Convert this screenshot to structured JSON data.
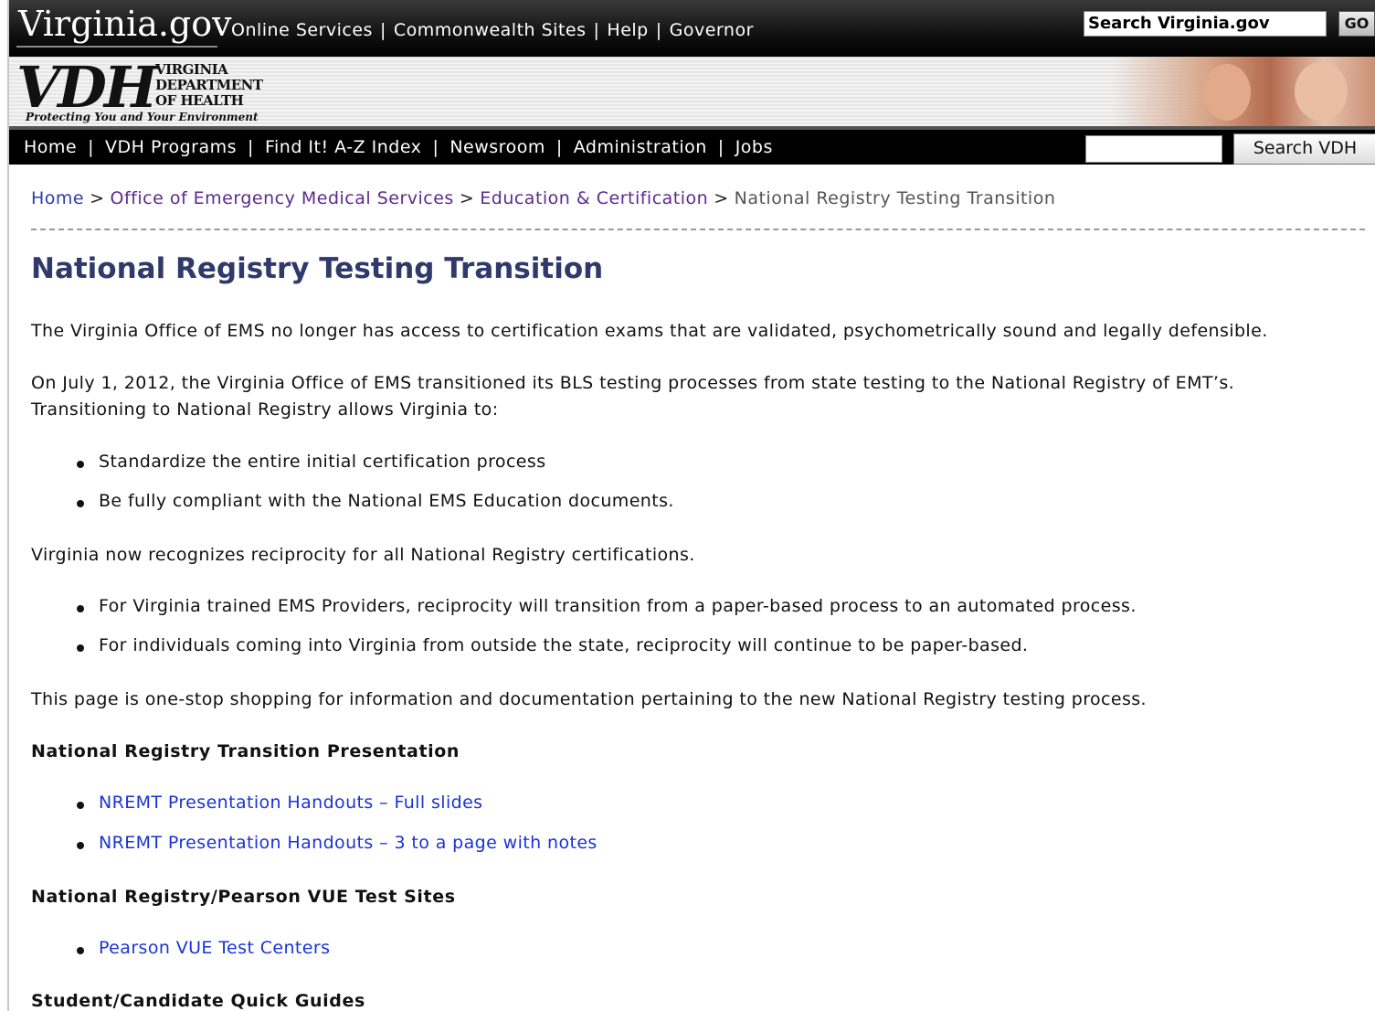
{
  "header": {
    "brand": "Virginia.gov",
    "nav": [
      "Online Services",
      "Commonwealth Sites",
      "Help",
      "Governor"
    ],
    "search_placeholder": "Search Virginia.gov",
    "go_label": "GO"
  },
  "banner": {
    "logo_letters": "VDH",
    "logo_lines": [
      "VIRGINIA",
      "DEPARTMENT",
      "OF HEALTH"
    ],
    "tagline": "Protecting You and Your Environment"
  },
  "mainnav": {
    "items": [
      "Home",
      "VDH Programs",
      "Find It! A-Z Index",
      "Newsroom",
      "Administration",
      "Jobs"
    ],
    "search_button": "Search VDH"
  },
  "breadcrumb": {
    "home": "Home",
    "level1": "Office of Emergency Medical Services",
    "level2": "Education & Certification",
    "current": "National Registry Testing Transition"
  },
  "page": {
    "title": "National Registry Testing Transition",
    "p1": "The Virginia Office of EMS no longer has access to certification exams that are validated, psychometrically sound and legally defensible.",
    "p2_line1": " On July 1, 2012, the Virginia Office of EMS transitioned its BLS testing processes from state testing to the National Registry of EMT’s.",
    "p2_line2": "Transitioning to National Registry allows Virginia to:",
    "list1": [
      "Standardize the entire initial certification process",
      "Be fully compliant with the National EMS Education documents."
    ],
    "p3": "Virginia now recognizes reciprocity for all National Registry certifications.",
    "list2": [
      "For Virginia trained EMS Providers, reciprocity will transition from a paper-based process to an automated process.",
      "For individuals coming into Virginia from outside the state, reciprocity will continue to be paper-based."
    ],
    "p4": "This page is one-stop shopping for information and documentation pertaining to the new National Registry testing process.",
    "section1_title": "National Registry Transition Presentation",
    "section1_links": [
      "NREMT Presentation Handouts – Full slides",
      "NREMT Presentation Handouts – 3 to a page with notes"
    ],
    "section2_title": "National Registry/Pearson VUE Test Sites",
    "section2_links": [
      "Pearson VUE Test Centers"
    ],
    "section3_title": "Student/Candidate Quick Guides"
  }
}
